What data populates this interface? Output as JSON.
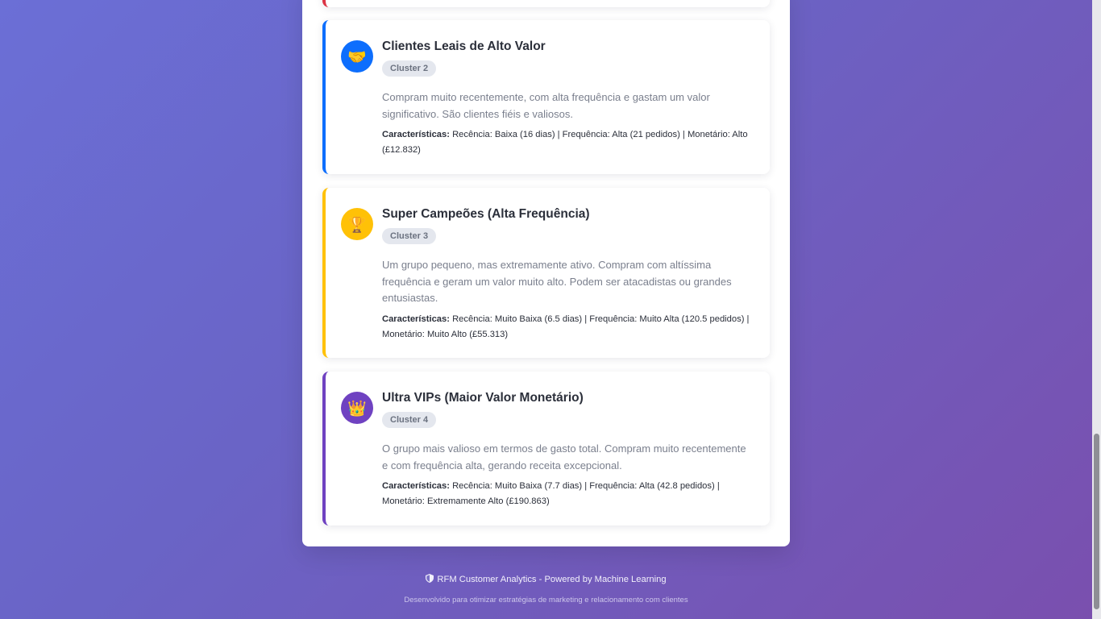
{
  "clusters": [
    {
      "icon": "handshake-icon",
      "icon_glyph": "🤝",
      "color": "#0d6efd",
      "title": "Clientes Leais de Alto Valor",
      "badge": "Cluster 2",
      "description": "Compram muito recentemente, com alta frequência e gastam um valor significativo. São clientes fiéis e valiosos.",
      "traits_label": "Características:",
      "traits": "Recência: Baixa (16 dias) | Frequência: Alta (21 pedidos) | Monetário: Alto (£12.832)"
    },
    {
      "icon": "trophy-icon",
      "icon_glyph": "🏆",
      "color": "#ffc107",
      "title": "Super Campeões (Alta Frequência)",
      "badge": "Cluster 3",
      "description": "Um grupo pequeno, mas extremamente ativo. Compram com altíssima frequência e geram um valor muito alto. Podem ser atacadistas ou grandes entusiastas.",
      "traits_label": "Características:",
      "traits": "Recência: Muito Baixa (6.5 dias) | Frequência: Muito Alta (120.5 pedidos) | Monetário: Muito Alto (£55.313)"
    },
    {
      "icon": "crown-icon",
      "icon_glyph": "👑",
      "color": "#6f42c1",
      "title": "Ultra VIPs (Maior Valor Monetário)",
      "badge": "Cluster 4",
      "description": "O grupo mais valioso em termos de gasto total. Compram muito recentemente e com frequência alta, gerando receita excepcional.",
      "traits_label": "Características:",
      "traits": "Recência: Muito Baixa (7.7 dias) | Frequência: Alta (42.8 pedidos) | Monetário: Extremamente Alto (£190.863)"
    }
  ],
  "footer": {
    "main": "RFM Customer Analytics - Powered by Machine Learning",
    "sub": "Desenvolvido para otimizar estratégias de marketing e relacionamento com clientes"
  }
}
